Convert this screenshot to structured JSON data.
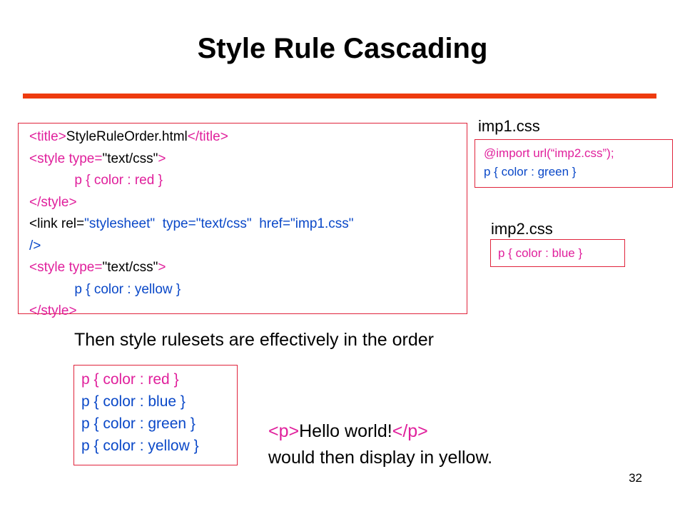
{
  "slide": {
    "title": "Style Rule Cascading",
    "page_number": "32"
  },
  "main_code": {
    "line1_open": "<title>",
    "line1_text": "StyleRuleOrder.html",
    "line1_close": "</title>",
    "line2_tag": "<style type=",
    "line2_value": "\"text/css\"",
    "line2_end": ">",
    "line3_indent": "            ",
    "line3_rule": "p { color : red }",
    "line4": "</style>",
    "line5_open": "<link rel=",
    "line5_rel": "\"stylesheet\"",
    "line5_type_attr": "  type=",
    "line5_type": "\"text/css\"",
    "line5_href_attr": "  href=",
    "line5_href": "\"imp1.css\"",
    "line6": "/>",
    "line7_tag": "<style type=",
    "line7_value": "\"text/css\"",
    "line7_end": ">",
    "line8_rule": "p { color : yellow }",
    "line9": "</style>"
  },
  "imp1": {
    "label": "imp1.css",
    "line1": "@import url(“imp2.css”);",
    "line2": "p { color : green }"
  },
  "imp2": {
    "label": "imp2.css",
    "line1": "p { color : blue }"
  },
  "summary": {
    "sentence": "Then style rulesets are effectively in the order",
    "order": [
      "p { color : red }",
      "p { color : blue }",
      "p { color : green }",
      "p { color : yellow }"
    ],
    "hello_open": "<p>",
    "hello_text": "Hello world!",
    "hello_close": "</p>",
    "hello_tail": "would then display in yellow."
  }
}
